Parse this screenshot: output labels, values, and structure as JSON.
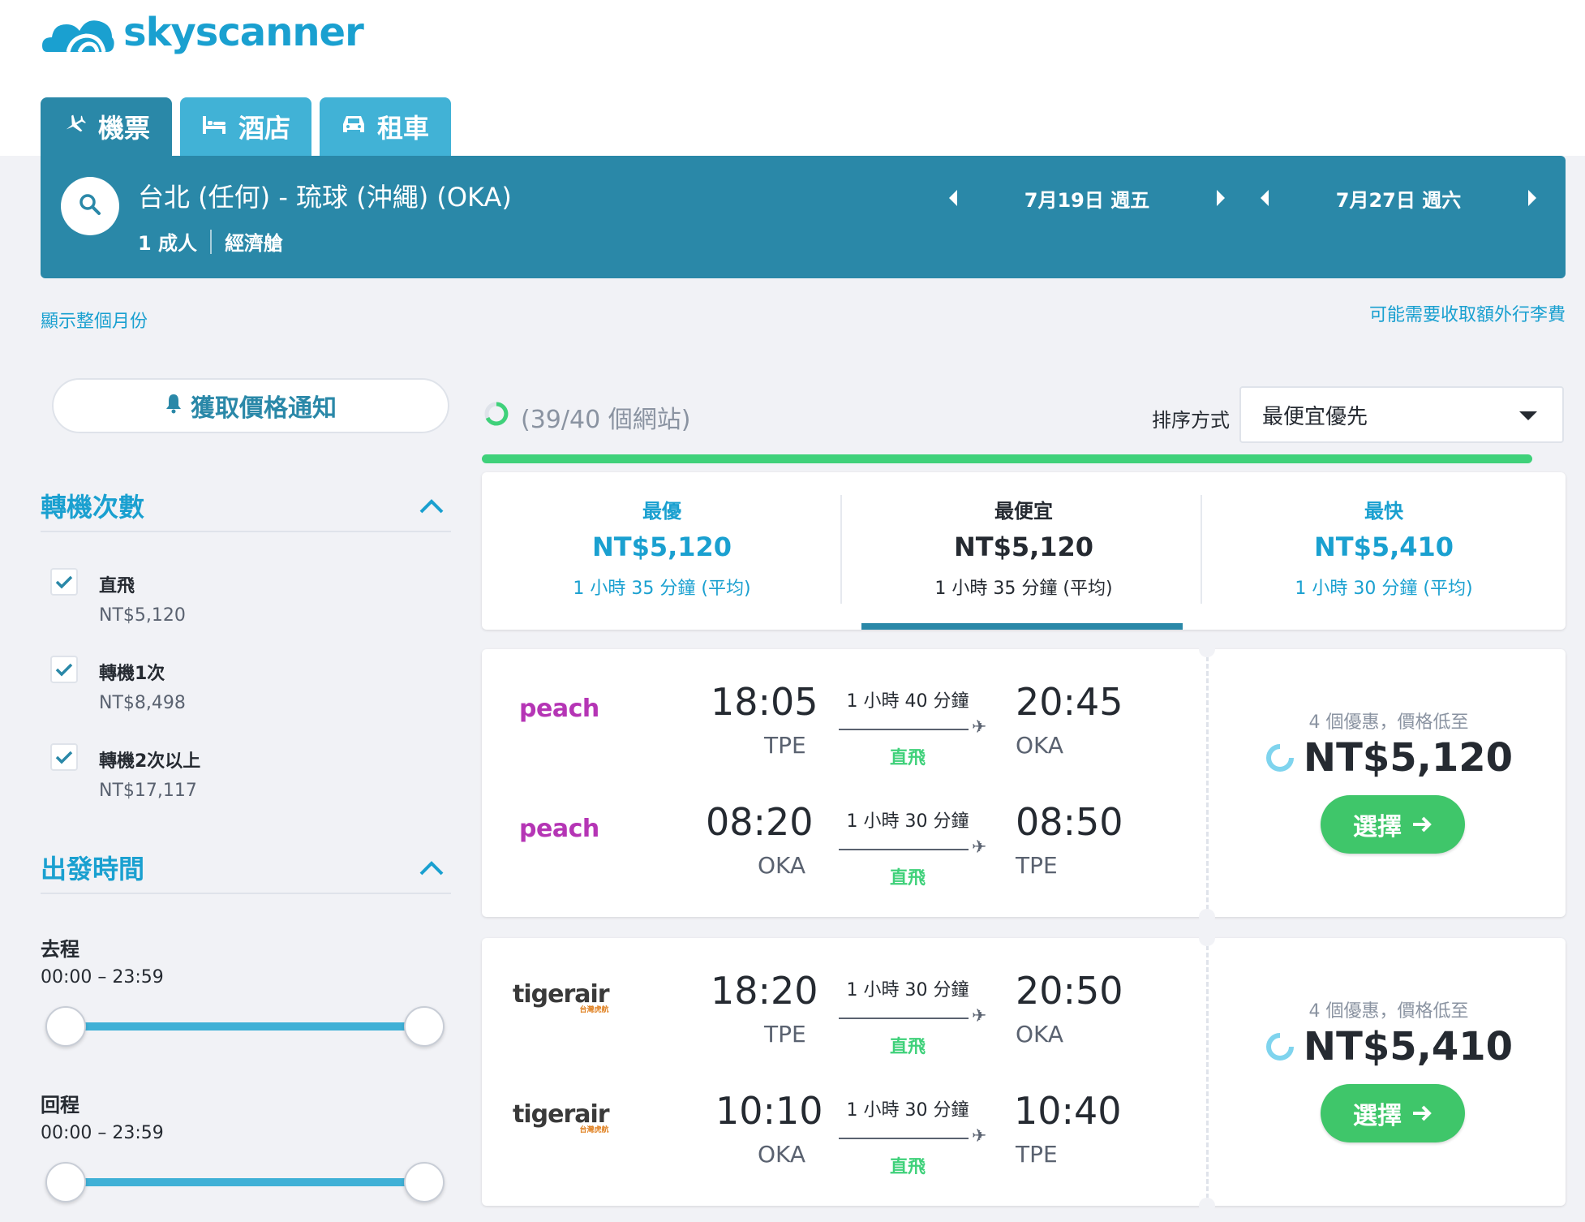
{
  "brand": {
    "name": "skyscanner",
    "color": "#1aa0d0"
  },
  "tabs": [
    {
      "label": "機票",
      "icon": "plane-icon"
    },
    {
      "label": "酒店",
      "icon": "bed-icon"
    },
    {
      "label": "租車",
      "icon": "car-icon"
    }
  ],
  "search": {
    "route": "台北 (任何) - 琉球 (沖繩) (OKA)",
    "passengers": "1 成人",
    "cabin": "經濟艙",
    "depart_date": "7月19日 週五",
    "return_date": "7月27日 週六"
  },
  "links": {
    "show_month": "顯示整個月份",
    "baggage_fee": "可能需要收取額外行李費"
  },
  "sidebar": {
    "alert_label": "獲取價格通知",
    "stops_title": "轉機次數",
    "stops": [
      {
        "label": "直飛",
        "price": "NT$5,120",
        "checked": true
      },
      {
        "label": "轉機1次",
        "price": "NT$8,498",
        "checked": true
      },
      {
        "label": "轉機2次以上",
        "price": "NT$17,117",
        "checked": true
      }
    ],
    "departure_title": "出發時間",
    "outbound_label": "去程",
    "outbound_range": "00:00 – 23:59",
    "return_label": "回程",
    "return_range": "00:00 – 23:59"
  },
  "results": {
    "progress_text": "(39/40 個網站)",
    "progress_fraction": 0.975,
    "sort_label": "排序方式",
    "sort_value": "最便宜優先",
    "summary": [
      {
        "label": "最優",
        "price": "NT$5,120",
        "duration": "1 小時 35 分鐘 (平均)"
      },
      {
        "label": "最便宜",
        "price": "NT$5,120",
        "duration": "1 小時 35 分鐘 (平均)"
      },
      {
        "label": "最快",
        "price": "NT$5,410",
        "duration": "1 小時 30 分鐘 (平均)"
      }
    ],
    "flights": [
      {
        "airline": "peach",
        "legs": [
          {
            "dep_time": "18:05",
            "dep": "TPE",
            "duration": "1 小時 40 分鐘",
            "stops": "直飛",
            "arr_time": "20:45",
            "arr": "OKA"
          },
          {
            "dep_time": "08:20",
            "dep": "OKA",
            "duration": "1 小時 30 分鐘",
            "stops": "直飛",
            "arr_time": "08:50",
            "arr": "TPE"
          }
        ],
        "deals": "4 個優惠，價格低至",
        "price": "NT$5,120",
        "select": "選擇"
      },
      {
        "airline": "tigerair",
        "airline_sub": "台灣虎航",
        "legs": [
          {
            "dep_time": "18:20",
            "dep": "TPE",
            "duration": "1 小時 30 分鐘",
            "stops": "直飛",
            "arr_time": "20:50",
            "arr": "OKA"
          },
          {
            "dep_time": "10:10",
            "dep": "OKA",
            "duration": "1 小時 30 分鐘",
            "stops": "直飛",
            "arr_time": "10:40",
            "arr": "TPE"
          }
        ],
        "deals": "4 個優惠，價格低至",
        "price": "NT$5,410",
        "select": "選擇"
      }
    ]
  }
}
